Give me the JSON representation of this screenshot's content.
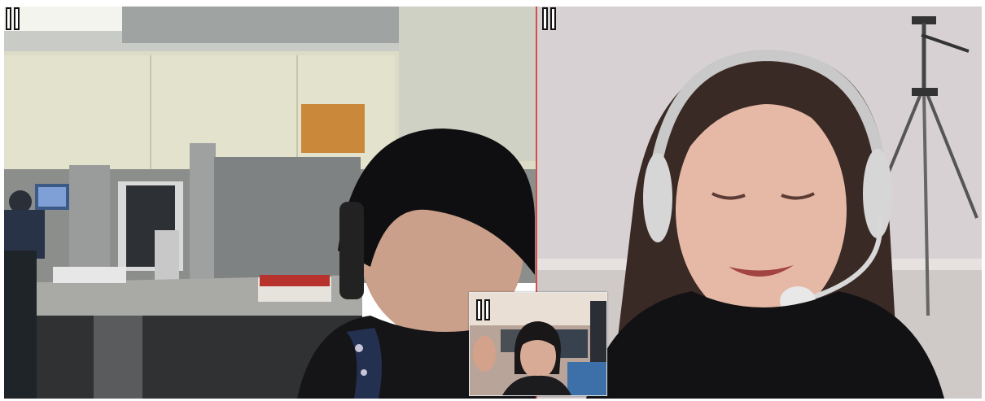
{
  "call": {
    "participants": [
      {
        "id": "remote-participant-1",
        "pause_icon": "pause-icon",
        "feed": "webcam-video"
      },
      {
        "id": "remote-participant-2",
        "pause_icon": "pause-icon",
        "feed": "webcam-video"
      },
      {
        "id": "self-preview",
        "pause_icon": "pause-icon",
        "feed": "webcam-video"
      }
    ]
  },
  "colors": {
    "divider": "#d3504a",
    "pause_fill": "#ffffff",
    "pause_border": "#111111"
  }
}
